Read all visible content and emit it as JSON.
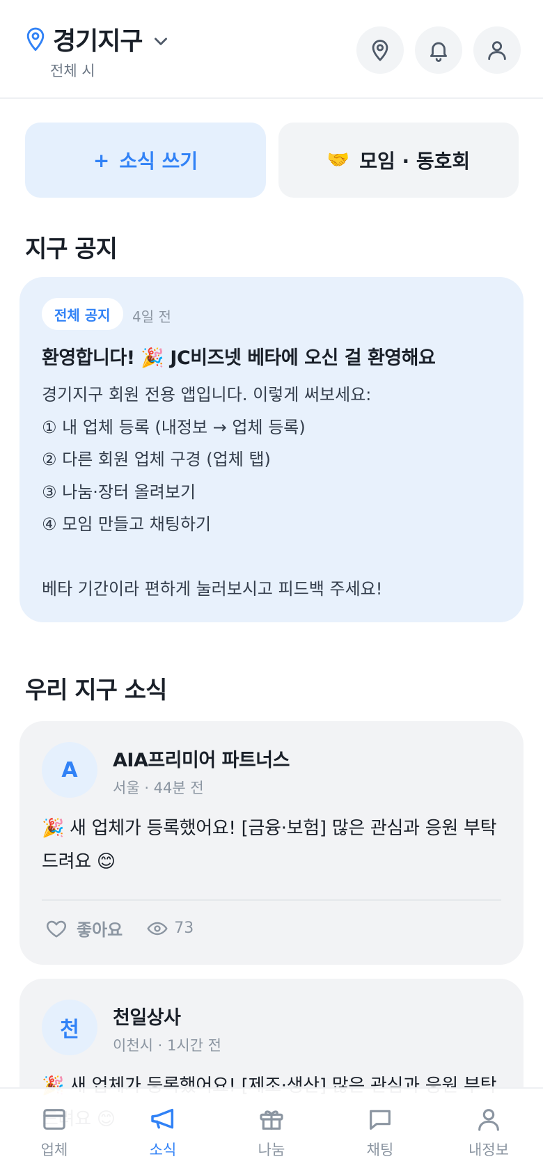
{
  "header": {
    "region_title": "경기지구",
    "region_sub": "전체 시"
  },
  "actions": {
    "write_label": "소식 쓰기",
    "write_plus": "+",
    "meet_label": "모임 · 동호회",
    "meet_emoji": "🤝"
  },
  "notice_section": {
    "title": "지구 공지",
    "badge": "전체 공지",
    "time": "4일 전",
    "post_title": "환영합니다! 🎉  JC비즈넷 베타에 오신 걸 환영해요",
    "body": "경기지구 회원 전용 앱입니다. 이렇게 써보세요:\n① 내 업체 등록 (내정보 → 업체 등록)\n② 다른 회원 업체 구경 (업체 탭)\n③ 나눔·장터 올려보기\n④ 모임 만들고 채팅하기\n\n베타 기간이라 편하게 눌러보시고 피드백 주세요!"
  },
  "news_section": {
    "title": "우리 지구 소식",
    "posts": [
      {
        "avatar": "A",
        "name": "AIA프리미어 파트너스",
        "meta": "서울 · 44분 전",
        "body": "🎉  새 업체가 등록했어요! [금융·보험] 많은 관심과 응원 부탁드려요 😊",
        "like_label": "좋아요",
        "views": "73"
      },
      {
        "avatar": "천",
        "name": "천일상사",
        "meta": "이천시 · 1시간 전",
        "body": "🎉  새 업체가 등록했어요! [제조·생산] 많은 관심과 응원 부탁드려요 😊"
      }
    ]
  },
  "nav": {
    "items": [
      {
        "label": "업체",
        "icon": "store-icon"
      },
      {
        "label": "소식",
        "icon": "megaphone-icon"
      },
      {
        "label": "나눔",
        "icon": "gift-icon"
      },
      {
        "label": "채팅",
        "icon": "chat-icon"
      },
      {
        "label": "내정보",
        "icon": "person-icon"
      }
    ],
    "active": "소식"
  },
  "colors": {
    "accent": "#3182f6",
    "notice_bg": "#e8f1fc",
    "card_bg": "#f2f3f5",
    "muted_text": "#8b95a1"
  }
}
